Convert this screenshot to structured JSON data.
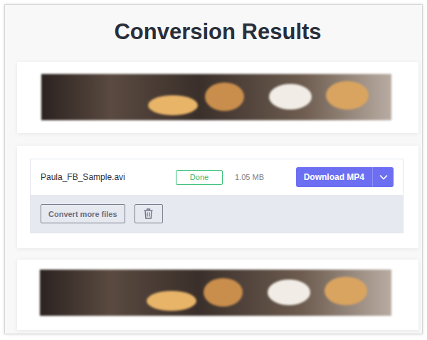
{
  "page": {
    "title": "Conversion Results"
  },
  "file": {
    "name": "Paula_FB_Sample.avi",
    "status": "Done",
    "size": "1.05 MB",
    "download": "Download MP4"
  },
  "actions": {
    "convert_more": "Convert more files"
  }
}
